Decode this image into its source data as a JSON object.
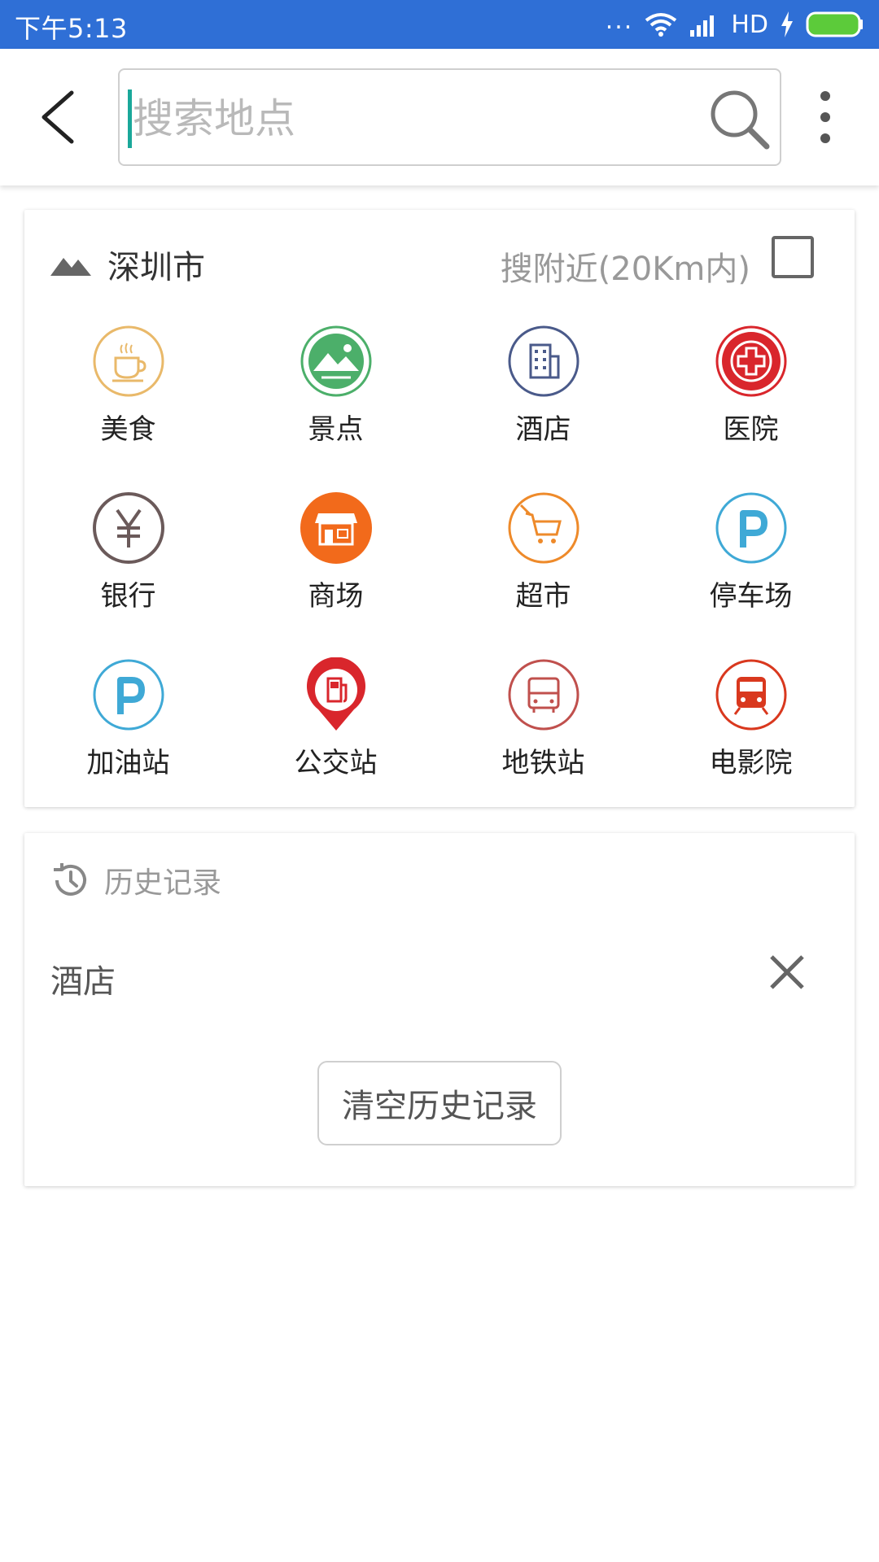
{
  "status_bar": {
    "time": "下午5:13",
    "network": "HD",
    "dots": "..."
  },
  "search": {
    "placeholder": "搜索地点"
  },
  "region": {
    "city": "深圳市",
    "nearby_label": "搜附近(20Km内)",
    "nearby_checked": false
  },
  "categories": [
    {
      "label": "美食",
      "icon": "coffee-cup-icon",
      "color": "#e9b96a"
    },
    {
      "label": "景点",
      "icon": "landscape-icon",
      "color": "#4caf6a"
    },
    {
      "label": "酒店",
      "icon": "building-icon",
      "color": "#4a5a8a"
    },
    {
      "label": "医院",
      "icon": "medical-cross-icon",
      "color": "#d9262c"
    },
    {
      "label": "银行",
      "icon": "yen-icon",
      "color": "#6b5a5a"
    },
    {
      "label": "商场",
      "icon": "storefront-icon",
      "color": "#f26a1b"
    },
    {
      "label": "超市",
      "icon": "shopping-cart-icon",
      "color": "#ee8a2a"
    },
    {
      "label": "停车场",
      "icon": "parking-icon",
      "color": "#3fa9d6"
    },
    {
      "label": "加油站",
      "icon": "parking-icon",
      "color": "#3fa9d6"
    },
    {
      "label": "公交站",
      "icon": "fuel-pump-icon",
      "color": "#d9262c"
    },
    {
      "label": "地铁站",
      "icon": "bus-icon",
      "color": "#c0504d"
    },
    {
      "label": "电影院",
      "icon": "train-icon",
      "color": "#d9381e"
    }
  ],
  "history": {
    "title": "历史记录",
    "items": [
      "酒店"
    ],
    "clear_label": "清空历史记录"
  }
}
